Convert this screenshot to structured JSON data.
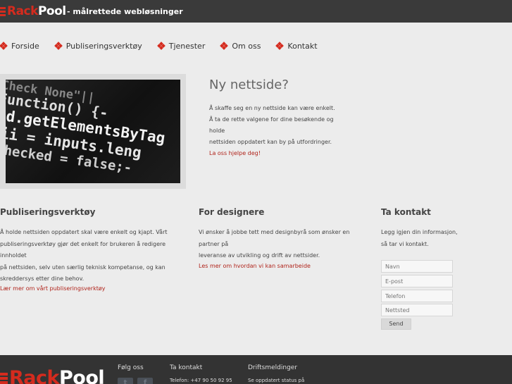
{
  "brand": {
    "name_part1": "Rack",
    "name_part2": "Pool",
    "tagline": "- målrettede webløsninger",
    "accent": "#d52b1e"
  },
  "nav": {
    "items": [
      {
        "label": "Forside"
      },
      {
        "label": "Publiseringsverktøy"
      },
      {
        "label": "Tjenester"
      },
      {
        "label": "Om oss"
      },
      {
        "label": "Kontakt"
      }
    ]
  },
  "hero": {
    "image_code": [
      "Check None\"||",
      "Function() {-",
      "$d.getElementsByTag",
      "ii = inputs.leng",
      "Checked = false;-"
    ],
    "title": "Ny nettside?",
    "text": [
      "Å skaffe seg en ny nettside kan være enkelt.",
      "Å ta de rette valgene for dine besøkende og holde",
      "nettsiden oppdatert kan by på utfordringer."
    ],
    "link": "La oss hjelpe deg!"
  },
  "columns": {
    "publishing": {
      "title": "Publiseringsverktøy",
      "text": [
        "Å holde nettsiden oppdatert skal være enkelt og kjapt. Vårt",
        "publiseringsverktøy gjør det enkelt for brukeren å redigere innholdet",
        "på nettsiden, selv uten særlig teknisk kompetanse, og kan",
        "skreddersys etter dine behov."
      ],
      "link": "Lær mer om vårt publiseringsverktøy"
    },
    "designers": {
      "title": "For designere",
      "text": [
        "Vi ønsker å jobbe tett med designbyrå som ønsker en partner på",
        "leveranse av utvikling og drift av nettsider."
      ],
      "link": "Les mer om hvordan vi kan samarbeide"
    },
    "contact": {
      "title": "Ta kontakt",
      "text": [
        "Legg igjen din informasjon,",
        "så tar vi kontakt."
      ],
      "fields": {
        "name": "Navn",
        "email": "E-post",
        "phone": "Telefon",
        "website": "Nettsted"
      },
      "send": "Send"
    }
  },
  "footer": {
    "follow": "Følg oss",
    "contact_title": "Ta kontakt",
    "contact_phone": "Telefon: +47 90 50 92 95",
    "ops_title": "Driftsmeldinger",
    "ops_text": "Se oppdatert status på",
    "twitter_icon": "t",
    "facebook_icon": "f"
  }
}
